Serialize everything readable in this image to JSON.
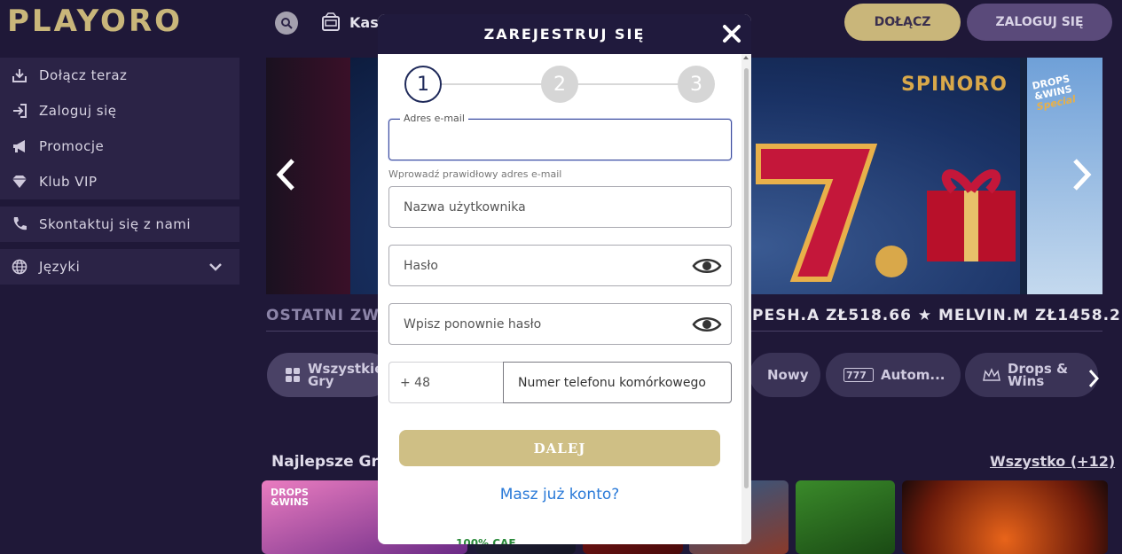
{
  "header": {
    "logo": "PLAYORO",
    "casino_label": "Kas",
    "join_label": "DOŁĄCZ",
    "login_label": "ZALOGUJ SIĘ"
  },
  "sidebar": {
    "items": [
      {
        "label": "Dołącz teraz",
        "icon": "download-icon"
      },
      {
        "label": "Zaloguj się",
        "icon": "login-icon"
      },
      {
        "label": "Promocje",
        "icon": "megaphone-icon"
      },
      {
        "label": "Klub VIP",
        "icon": "diamond-icon"
      }
    ],
    "contact": {
      "label": "Skontaktuj się z nami",
      "icon": "phone-icon"
    },
    "languages": {
      "label": "Języki",
      "icon": "globe-icon"
    }
  },
  "banner": {
    "brand": "SPINORO",
    "drops_top": "DROPS",
    "drops_mid": "&WINS",
    "drops_special": "Special"
  },
  "ticker": {
    "title": "OSTATNI ZW",
    "text": "PESH.A ZŁ518.66  ★ MELVIN.M ZŁ1458.2"
  },
  "categories": {
    "all_line1": "Wszystkie",
    "all_line2": "Gry",
    "new": "Nowy",
    "auto": "Autom...",
    "drops_line1": "Drops &",
    "drops_line2": "Wins"
  },
  "games": {
    "title": "Najlepsze Gry",
    "all_link": "Wszystko (+12)",
    "tile1_badge_top": "DROPS",
    "tile1_badge_bottom": "&WINS"
  },
  "modal": {
    "title": "ZAREJESTRUJ SIĘ",
    "steps": [
      "1",
      "2",
      "3"
    ],
    "email_legend": "Adres e-mail",
    "email_value": "",
    "email_hint": "Wprowadź prawidłowy adres e-mail",
    "username_placeholder": "Nazwa użytkownika",
    "password_placeholder": "Hasło",
    "password2_placeholder": "Wpisz ponownie hasło",
    "phone_code": "+ 48",
    "phone_placeholder": "Numer telefonu komórkowego",
    "next_label": "DALEJ",
    "have_account": "Masz już konto?",
    "peek_text": "100% CAF"
  },
  "colors": {
    "background": "#1f1838",
    "gold": "#c9b67a",
    "modal_header": "#201a3d",
    "link_blue": "#2a7ad8"
  }
}
